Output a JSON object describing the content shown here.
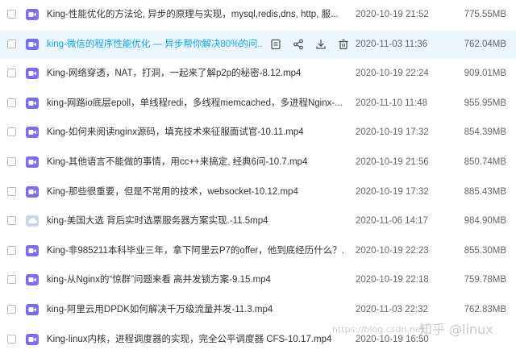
{
  "files": [
    {
      "name": "King-性能优化的方法论, 异步的原理与实现，mysql,redis,dns, http, 服...",
      "date": "2020-10-19 21:52",
      "size": "775.55MB",
      "icon": "video-icon",
      "selected": false
    },
    {
      "name": "king-微信的程序性能优化 — 异步帮你解决80%的问...",
      "date": "2020-11-03 11:36",
      "size": "762.04MB",
      "icon": "video-icon",
      "selected": true
    },
    {
      "name": "King-网络穿透，NAT，打洞，一起来了解p2p的秘密-8.12.mp4",
      "date": "2020-10-19 22:24",
      "size": "909.01MB",
      "icon": "video-icon",
      "selected": false
    },
    {
      "name": "king-网路io底层epoll，单线程redi，多线程memcached，多进程Nginx-...",
      "date": "2020-11-10 11:48",
      "size": "955.95MB",
      "icon": "video-icon",
      "selected": false
    },
    {
      "name": "King-如何来阅读nginx源码，填充技术来征服面试官-10.11.mp4",
      "date": "2020-10-19 17:32",
      "size": "854.39MB",
      "icon": "video-icon",
      "selected": false
    },
    {
      "name": "King-其他语言不能做的事情，用cc++来搞定, 经典6问-10.7.mp4",
      "date": "2020-10-19 21:56",
      "size": "850.74MB",
      "icon": "video-icon",
      "selected": false
    },
    {
      "name": "King-那些很重要，但是不常用的技术，websocket-10.12.mp4",
      "date": "2020-10-19 17:32",
      "size": "885.43MB",
      "icon": "video-icon",
      "selected": false
    },
    {
      "name": "king-美国大选 背后实时选票服务器方案实现.-11.5mp4",
      "date": "2020-11-06 14:17",
      "size": "984.90MB",
      "icon": "cloud-file-icon",
      "selected": false
    },
    {
      "name": "King-非985211本科毕业三年，拿下阿里云P7的offer，他到底经历什么？...",
      "date": "2020-10-19 22:23",
      "size": "855.30MB",
      "icon": "video-icon",
      "selected": false
    },
    {
      "name": "king-从Nginx的“惊群”问题来看 高并发锁方案-9.15.mp4",
      "date": "2020-10-19 22:18",
      "size": "759.78MB",
      "icon": "video-icon",
      "selected": false
    },
    {
      "name": "king-阿里云用DPDK如何解决千万级流量并发-11.3.mp4",
      "date": "2020-11-03 22:32",
      "size": "762.83MB",
      "icon": "video-icon",
      "selected": false
    },
    {
      "name": "King-linux内核，进程调度器的实现，完全公平调度器 CFS-10.17.mp4",
      "date": "2020-10-19 16:50",
      "size": "",
      "icon": "video-icon",
      "selected": false
    }
  ],
  "row_actions": [
    "notes-icon",
    "share-icon",
    "download-icon",
    "delete-icon"
  ],
  "watermark": {
    "url": "https://blog.csdn.net",
    "text": "知乎 @linux"
  },
  "colors": {
    "accent": "#06a7ff",
    "video_icon": "#7b6cf6",
    "selected_row": "#eef7ff"
  }
}
